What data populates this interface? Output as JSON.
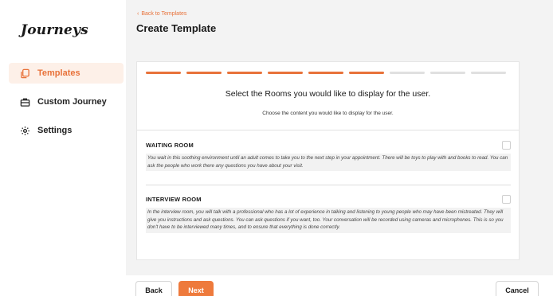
{
  "app": {
    "logo": "Journeys"
  },
  "sidebar": {
    "items": [
      {
        "label": "Templates",
        "icon": "copy-icon",
        "active": true
      },
      {
        "label": "Custom Journey",
        "icon": "briefcase-icon",
        "active": false
      },
      {
        "label": "Settings",
        "icon": "gear-icon",
        "active": false
      }
    ]
  },
  "header": {
    "back_label": "Back to Templates",
    "title": "Create Template"
  },
  "wizard": {
    "steps_total": 9,
    "steps_completed": 6,
    "heading": "Select the Rooms you would like to display for the user.",
    "subheading": "Choose the content you would like to display for the user.",
    "rooms": [
      {
        "title": "WAITING ROOM",
        "description": "You wait in this soothing environment until an adult comes to take you to the next step in your appointment. There will be toys to play with and books to read. You can ask the people who work there any questions you have about your visit.",
        "checked": false
      },
      {
        "title": "INTERVIEW ROOM",
        "description": "In the interview room, you will talk with a professional who has a lot of experience in talking and listening to young people who may have been mistreated. They will give you instructions and ask questions. You can ask questions if you want, too. Your conversation will be recorded using cameras and microphones. This is so you don't have to be interviewed many times, and to ensure that everything is done correctly.",
        "checked": false
      }
    ]
  },
  "footer": {
    "back_label": "Back",
    "next_label": "Next",
    "cancel_label": "Cancel"
  },
  "colors": {
    "accent": "#e8723a",
    "active_bg": "#fdf0e8",
    "main_bg": "#f3f3f3"
  }
}
